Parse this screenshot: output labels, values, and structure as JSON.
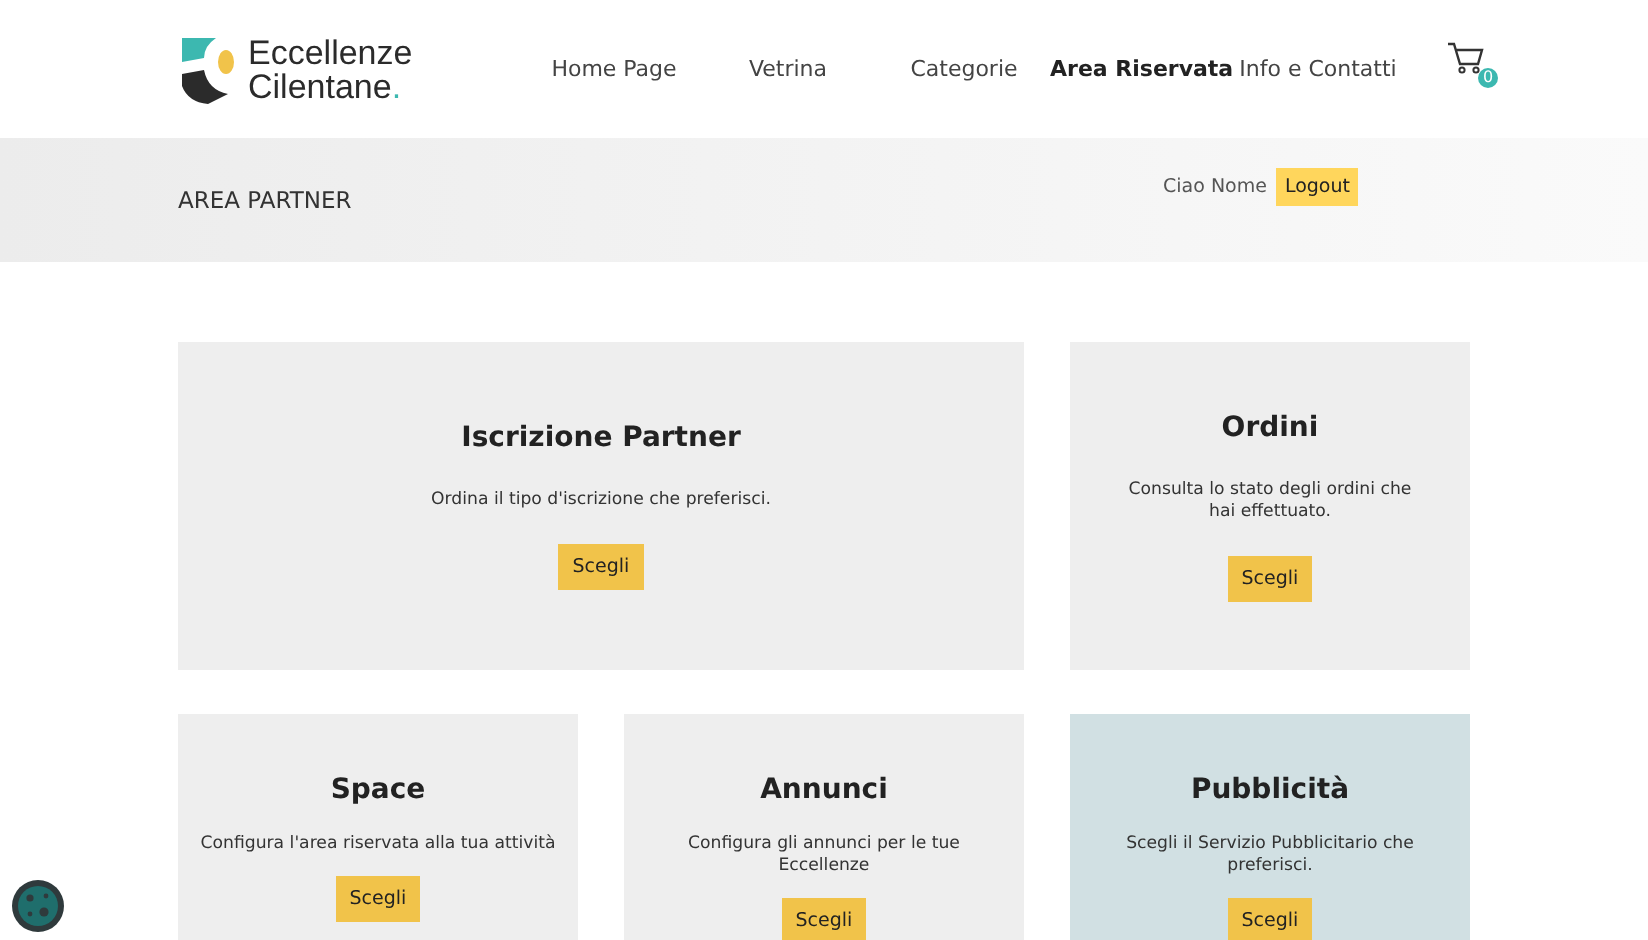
{
  "logo": {
    "line1": "Eccellenze",
    "line2": "Cilentane",
    "dot": "."
  },
  "nav": [
    {
      "label": "Home Page",
      "selected": false
    },
    {
      "label": "Vetrina",
      "selected": false
    },
    {
      "label": "Categorie",
      "selected": false
    },
    {
      "label": "Area Riservata",
      "selected": true
    },
    {
      "label": "Info e Contatti",
      "selected": false
    }
  ],
  "cart": {
    "count": "0"
  },
  "band": {
    "title": "AREA PARTNER",
    "greeting": "Ciao Nome",
    "logout": "Logout"
  },
  "cards": [
    {
      "title": "Iscrizione Partner",
      "text": "Ordina il tipo d'iscrizione che preferisci.",
      "button": "Scegli",
      "wide": true,
      "highlighted": false
    },
    {
      "title": "Ordini",
      "text": "Consulta lo stato degli ordini che hai effettuato.",
      "button": "Scegli",
      "wide": false,
      "highlighted": false
    },
    {
      "title": "Space",
      "text": "Configura l'area riservata alla tua attività",
      "button": "Scegli",
      "wide": false,
      "highlighted": false
    },
    {
      "title": "Annunci",
      "text": "Configura gli annunci per le tue Eccellenze",
      "button": "Scegli",
      "wide": false,
      "highlighted": false
    },
    {
      "title": "Pubblicità",
      "text": "Scegli il Servizio Pubblicitario che preferisci.",
      "button": "Scegli",
      "wide": false,
      "highlighted": true
    }
  ]
}
